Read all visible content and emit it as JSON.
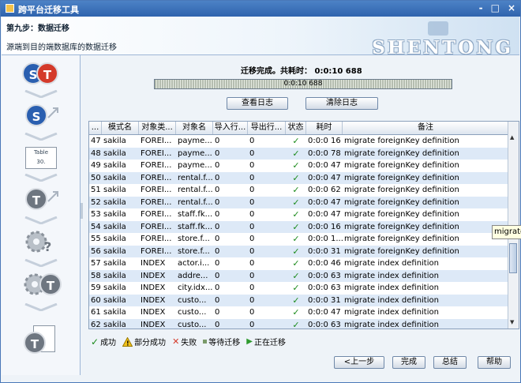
{
  "window": {
    "title": "跨平台迁移工具",
    "controls": [
      "-",
      "□",
      "×"
    ]
  },
  "banner": {
    "step": "第九步：数据迁移",
    "desc": "源端到目的端数据库的数据迁移",
    "brand": "SHENTONG"
  },
  "status": {
    "text": "迁移完成。共耗时： 0:0:10 688",
    "progress_text": "0:0:10 688",
    "progress": 1.0
  },
  "actions": {
    "view_log": "查看日志",
    "clear_log": "清除日志"
  },
  "table": {
    "columns": [
      "...",
      "模式名",
      "对象类...",
      "对象名",
      "导入行...",
      "导出行...",
      "状态",
      "耗时",
      "备注"
    ],
    "rows": [
      [
        "47",
        "sakila",
        "FOREI...",
        "payme...",
        "0",
        "0",
        "✓",
        "0:0:0 16",
        "migrate foreignKey definition"
      ],
      [
        "48",
        "sakila",
        "FOREI...",
        "payme...",
        "0",
        "0",
        "✓",
        "0:0:0 78",
        "migrate foreignKey definition"
      ],
      [
        "49",
        "sakila",
        "FOREI...",
        "payme...",
        "0",
        "0",
        "✓",
        "0:0:0 47",
        "migrate foreignKey definition"
      ],
      [
        "50",
        "sakila",
        "FOREI...",
        "rental.f...",
        "0",
        "0",
        "✓",
        "0:0:0 47",
        "migrate foreignKey definition"
      ],
      [
        "51",
        "sakila",
        "FOREI...",
        "rental.f...",
        "0",
        "0",
        "✓",
        "0:0:0 62",
        "migrate foreignKey definition"
      ],
      [
        "52",
        "sakila",
        "FOREI...",
        "rental.f...",
        "0",
        "0",
        "✓",
        "0:0:0 47",
        "migrate foreignKey definition"
      ],
      [
        "53",
        "sakila",
        "FOREI...",
        "staff.fk...",
        "0",
        "0",
        "✓",
        "0:0:0 47",
        "migrate foreignKey definition"
      ],
      [
        "54",
        "sakila",
        "FOREI...",
        "staff.fk...",
        "0",
        "0",
        "✓",
        "0:0:0 16",
        "migrate foreignKey definition"
      ],
      [
        "55",
        "sakila",
        "FOREI...",
        "store.f...",
        "0",
        "0",
        "✓",
        "0:0:0 1...",
        "migrate foreignKey definition"
      ],
      [
        "56",
        "sakila",
        "FOREI...",
        "store.f...",
        "0",
        "0",
        "✓",
        "0:0:0 31",
        "migrate foreignKey definition"
      ],
      [
        "57",
        "sakila",
        "INDEX",
        "actor.i...",
        "0",
        "0",
        "✓",
        "0:0:0 46",
        "migrate index definition"
      ],
      [
        "58",
        "sakila",
        "INDEX",
        "addre...",
        "0",
        "0",
        "✓",
        "0:0:0 63",
        "migrate index definition"
      ],
      [
        "59",
        "sakila",
        "INDEX",
        "city.idx...",
        "0",
        "0",
        "✓",
        "0:0:0 63",
        "migrate index definition"
      ],
      [
        "60",
        "sakila",
        "INDEX",
        "custo...",
        "0",
        "0",
        "✓",
        "0:0:0 31",
        "migrate index definition"
      ],
      [
        "61",
        "sakila",
        "INDEX",
        "custo...",
        "0",
        "0",
        "✓",
        "0:0:0 47",
        "migrate index definition"
      ],
      [
        "62",
        "sakila",
        "INDEX",
        "custo...",
        "0",
        "0",
        "✓",
        "0:0:0 63",
        "migrate index definition"
      ]
    ]
  },
  "tooltip": "migrate",
  "legend": {
    "success": "成功",
    "partial": "部分成功",
    "fail": "失败",
    "waiting": "等待迁移",
    "running": "正在迁移"
  },
  "footer": {
    "prev": "<上一步",
    "finish": "完成",
    "summary": "总结",
    "help": "帮助"
  },
  "sidebar": {
    "items": [
      {
        "icon": "source-target-icon",
        "letters": "S T"
      },
      {
        "icon": "source-connect-icon",
        "letters": "S"
      },
      {
        "icon": "table-icon",
        "letters": "Table"
      },
      {
        "icon": "target-connect-icon",
        "letters": "T"
      },
      {
        "icon": "settings-help-icon",
        "letters": "?"
      },
      {
        "icon": "migrate-gears-icon",
        "letters": "T"
      },
      {
        "icon": "report-icon",
        "letters": "T"
      }
    ]
  },
  "colors": {
    "titlebar": "#2f63ad",
    "accent_red": "#d43a2a",
    "accent_blue": "#2a5fb0",
    "check_green": "#1a8a1a",
    "row_alt": "#dde9f7"
  }
}
